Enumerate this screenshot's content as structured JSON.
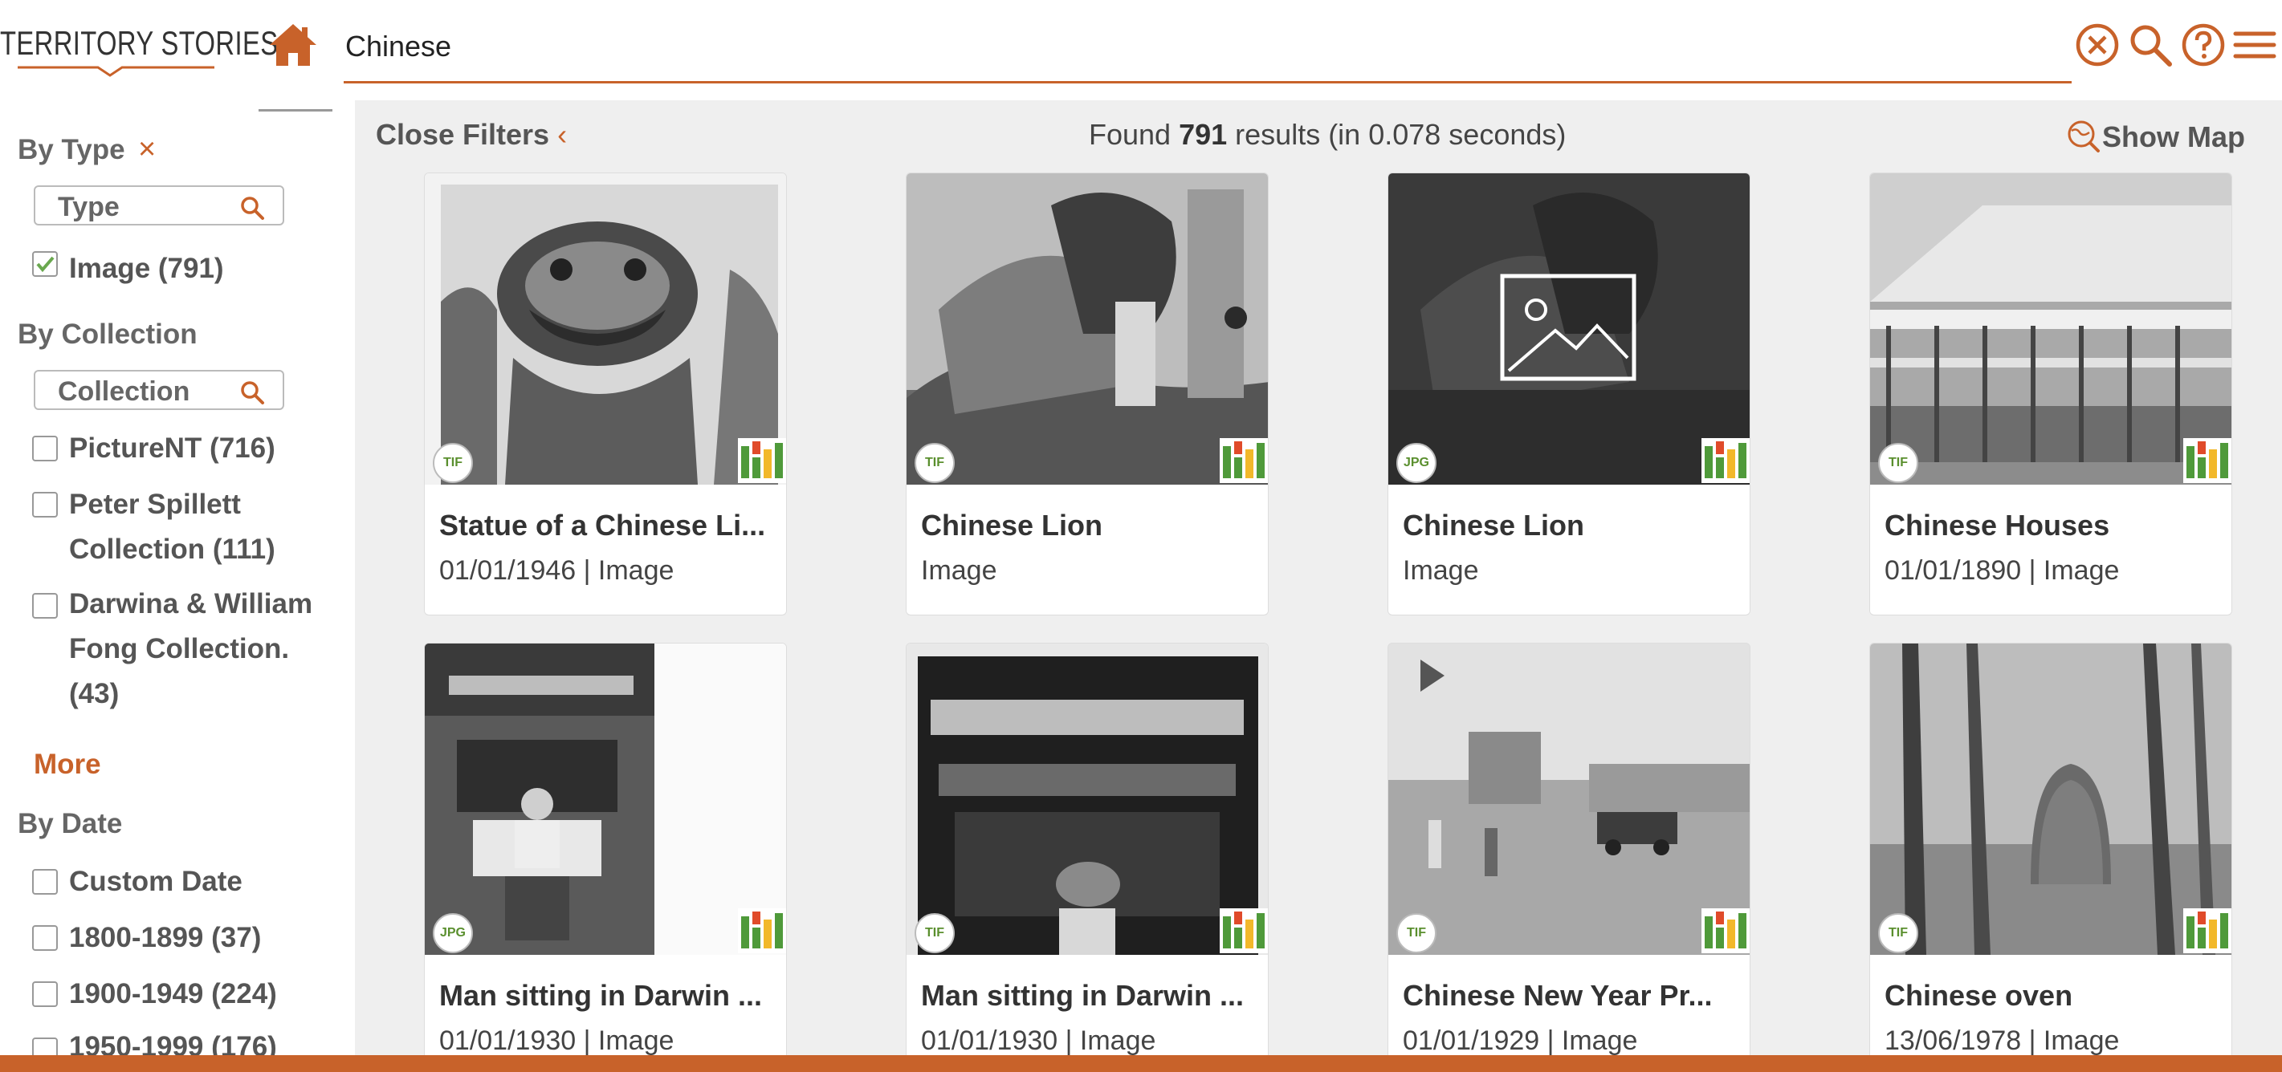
{
  "header": {
    "logo_text": "TERRITORY STORIES",
    "search_value": "Chinese",
    "accent_color": "#c8622a",
    "icons": [
      "home-icon",
      "clear-icon",
      "search-icon",
      "help-icon",
      "menu-icon"
    ]
  },
  "sidebar": {
    "by_type": {
      "heading": "By Type",
      "clear": "×",
      "search_placeholder": "Type",
      "items": [
        {
          "label": "Image (791)",
          "checked": true
        }
      ]
    },
    "by_collection": {
      "heading": "By Collection",
      "search_placeholder": "Collection",
      "items": [
        {
          "label": "PictureNT (716)",
          "checked": false
        },
        {
          "label_line1": "Peter Spillett",
          "label_line2": "Collection (111)",
          "checked": false
        },
        {
          "label_line1": "Darwina & William",
          "label_line2": "Fong Collection.",
          "label_line3": "(43)",
          "checked": false
        }
      ],
      "more": "More"
    },
    "by_date": {
      "heading": "By Date",
      "items": [
        {
          "label": "Custom Date",
          "checked": false
        },
        {
          "label": "1800-1899 (37)",
          "checked": false
        },
        {
          "label": "1900-1949 (224)",
          "checked": false
        },
        {
          "label": "1950-1999 (176)",
          "checked": false
        }
      ]
    }
  },
  "toolbar": {
    "close_filters": "Close Filters",
    "close_chevron": "‹",
    "results_prefix": "Found ",
    "results_count": "791",
    "results_suffix": " results (in 0.078 seconds)",
    "show_map": "Show Map"
  },
  "results": [
    {
      "title": "Statue of a Chinese Li...",
      "meta": "01/01/1946 | Image",
      "format": "TIF"
    },
    {
      "title": "Chinese Lion",
      "meta": "Image",
      "format": "TIF"
    },
    {
      "title": "Chinese Lion",
      "meta": "Image",
      "format": "JPG"
    },
    {
      "title": "Chinese Houses",
      "meta": "01/01/1890 | Image",
      "format": "TIF"
    },
    {
      "title": "Man sitting in Darwin ...",
      "meta": "01/01/1930 | Image",
      "format": "JPG"
    },
    {
      "title": "Man sitting in Darwin ...",
      "meta": "01/01/1930 | Image",
      "format": "TIF"
    },
    {
      "title": "Chinese New Year Pr...",
      "meta": "01/01/1929 | Image",
      "format": "TIF"
    },
    {
      "title": "Chinese oven",
      "meta": "13/06/1978 | Image",
      "format": "TIF"
    }
  ]
}
